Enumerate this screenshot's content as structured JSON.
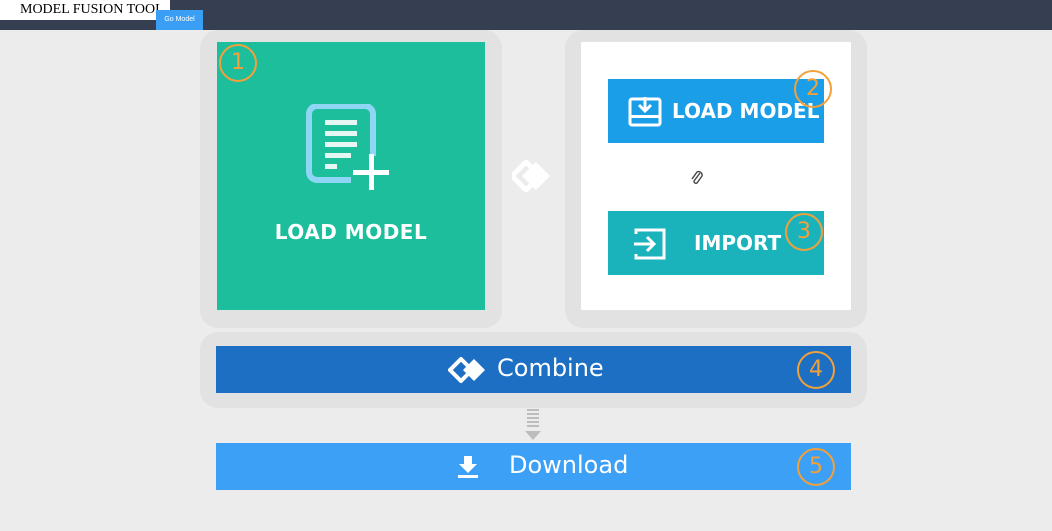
{
  "topbar": {
    "app_title": "MODEL FUSION TOOL",
    "go_button": "Go Model"
  },
  "load_card": {
    "label": "LOAD MODEL",
    "icon": "document-add-icon",
    "color": "#1dbe9c"
  },
  "right_card": {
    "load_button": "LOAD MODEL",
    "load_icon": "download-tray-icon",
    "attachment_icon": "paperclip-icon",
    "import_button": "IMPORT",
    "import_icon": "import-arrow-icon"
  },
  "combine": {
    "label": "Combine",
    "icon": "diamond-link-icon",
    "color": "#1c6fc2"
  },
  "download": {
    "label": "Download",
    "icon": "download-arrow-icon",
    "color": "#3ba0f6"
  },
  "step_numbers": [
    "1",
    "2",
    "3",
    "4",
    "5"
  ],
  "accent_color": "#f2a03a"
}
